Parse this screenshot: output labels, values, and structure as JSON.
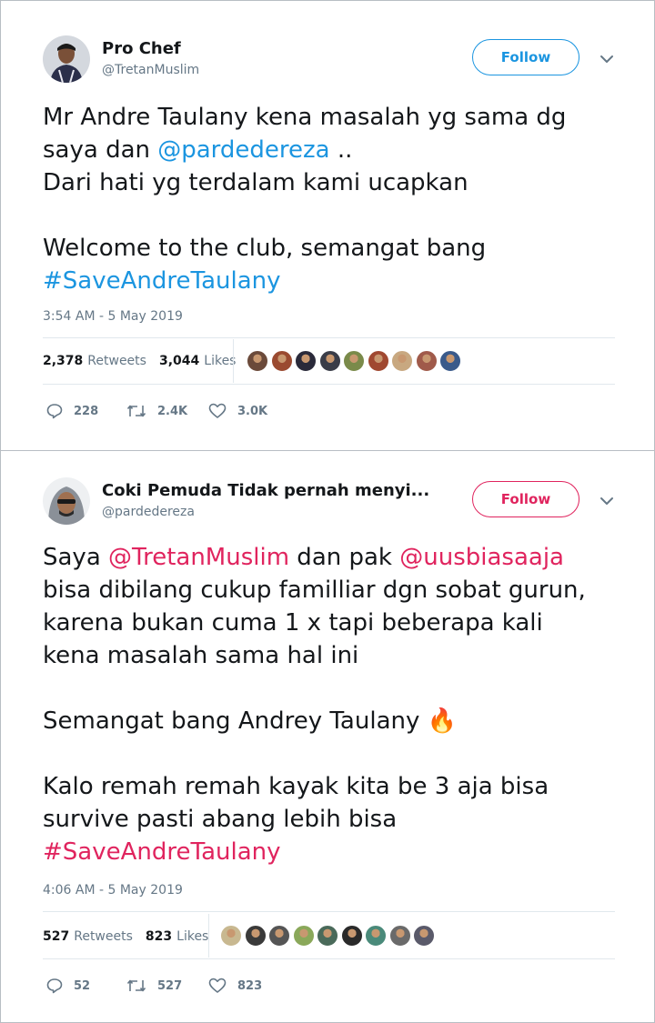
{
  "tweets": [
    {
      "name": "Pro Chef",
      "handle": "@TretanMuslim",
      "follow_label": "Follow",
      "accent_color": "#1b95e0",
      "body_lines": [
        [
          {
            "t": "Mr Andre Taulany kena masalah yg sama dg",
            "link": false
          }
        ],
        [
          {
            "t": "saya dan ",
            "link": false
          },
          {
            "t": "@pardedereza",
            "link": true
          },
          {
            "t": " ..",
            "link": false
          }
        ],
        [
          {
            "t": "Dari hati yg terdalam kami ucapkan",
            "link": false
          }
        ],
        [],
        [
          {
            "t": "Welcome to the club, semangat bang",
            "link": false
          }
        ],
        [
          {
            "t": "#SaveAndreTaulany",
            "link": true
          }
        ]
      ],
      "timestamp": "3:54 AM - 5 May 2019",
      "retweets": "2,378",
      "retweets_label": "Retweets",
      "likes": "3,044",
      "likes_label": "Likes",
      "reply_count": "228",
      "retweet_count": "2.4K",
      "like_count": "3.0K",
      "liker_colors": [
        "#6b4a3a",
        "#9a4a30",
        "#2a2a3a",
        "#3a3d48",
        "#7a8a4a",
        "#a04830",
        "#c8a880",
        "#a05a4a",
        "#3a5a8a"
      ]
    },
    {
      "name": "Coki Pemuda Tidak pernah menyi...",
      "handle": "@pardedereza",
      "follow_label": "Follow",
      "accent_color": "#e0245e",
      "body_lines": [
        [
          {
            "t": "Saya ",
            "link": false
          },
          {
            "t": "@TretanMuslim",
            "link": true
          },
          {
            "t": " dan pak ",
            "link": false
          },
          {
            "t": "@uusbiasaaja",
            "link": true
          }
        ],
        [
          {
            "t": "bisa dibilang cukup familliar dgn sobat gurun,",
            "link": false
          }
        ],
        [
          {
            "t": "karena bukan cuma 1 x tapi beberapa kali",
            "link": false
          }
        ],
        [
          {
            "t": "kena masalah sama hal ini",
            "link": false
          }
        ],
        [],
        [
          {
            "t": "Semangat bang Andrey Taulany ",
            "link": false
          },
          {
            "t": "🔥",
            "emoji": true
          }
        ],
        [],
        [
          {
            "t": "Kalo remah remah kayak kita be 3 aja bisa",
            "link": false
          }
        ],
        [
          {
            "t": "survive pasti abang lebih bisa",
            "link": false
          }
        ],
        [
          {
            "t": "#SaveAndreTaulany",
            "link": true
          }
        ]
      ],
      "timestamp": "4:06 AM - 5 May 2019",
      "retweets": "527",
      "retweets_label": "Retweets",
      "likes": "823",
      "likes_label": "Likes",
      "reply_count": "52",
      "retweet_count": "527",
      "like_count": "823",
      "liker_colors": [
        "#c8b890",
        "#3a3a3a",
        "#555555",
        "#8aa85a",
        "#4a6a5a",
        "#2a2a2a",
        "#4a8a7a",
        "#6a6a6a",
        "#5a5a6a"
      ]
    }
  ]
}
